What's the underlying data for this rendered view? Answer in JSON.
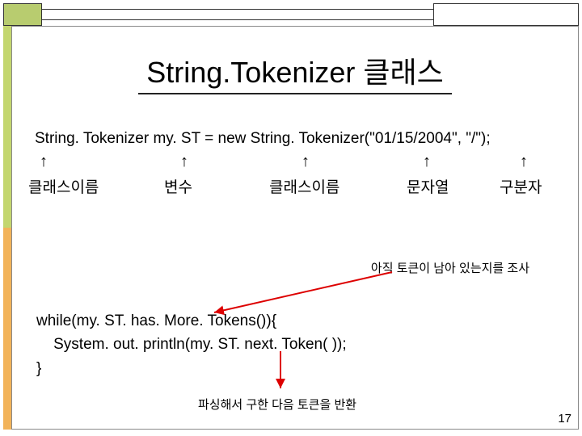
{
  "title": "String.Tokenizer 클래스",
  "code_line": "String. Tokenizer my. ST = new String. Tokenizer(\"01/15/2004\", \"/\");",
  "arrows": {
    "a1": "↑",
    "a2": "↑",
    "a3": "↑",
    "a4": "↑",
    "a5": "↑"
  },
  "labels": {
    "classname1": "클래스이름",
    "variable": "변수",
    "classname2": "클래스이름",
    "stringlit": "문자열",
    "delimiter": "구분자"
  },
  "note_tokens_remaining": "아직 토큰이 남아 있는지를 조사",
  "code_block": {
    "l1": "while(my. ST. has. More. Tokens()){",
    "l2": "    System. out. println(my. ST. next. Token( ));",
    "l3": "}"
  },
  "note_return_token": "파싱해서 구한 다음 토큰을 반환",
  "page_number": "17"
}
